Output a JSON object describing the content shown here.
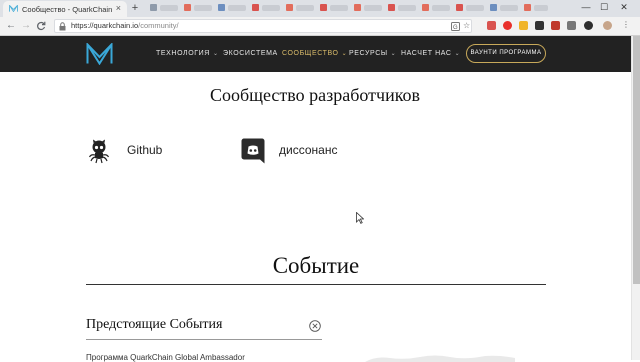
{
  "browser": {
    "tab_title": "Сообщество - QuarkChain",
    "tab_close": "×",
    "new_tab": "+",
    "window_controls": {
      "minimize": "—",
      "maximize": "☐",
      "close": "✕"
    },
    "nav": {
      "back": "←",
      "forward": "→",
      "reload": "C"
    },
    "url_host": "https://quarkchain.io",
    "url_path": "/community/"
  },
  "site": {
    "menu": [
      {
        "label": "ТЕХНОЛОГИЯ",
        "has_caret": true
      },
      {
        "label": "ЭКОСИСТЕМА",
        "has_caret": false
      },
      {
        "label": "СООБЩЕСТВО",
        "has_caret": true,
        "active": true
      },
      {
        "label": "РЕСУРСЫ",
        "has_caret": true
      },
      {
        "label": "НАСЧЕТ НАС",
        "has_caret": true
      }
    ],
    "caret": "⌄",
    "cta_label": "ВАУНТИ ПРОГРАММА",
    "accent_color": "#d9bb6a",
    "header_bg": "#222222"
  },
  "content": {
    "dev_heading": "Сообщество разработчиков",
    "links": [
      {
        "label": "Github",
        "icon": "github-icon"
      },
      {
        "label": "диссонанс",
        "icon": "discord-icon"
      }
    ],
    "event_heading": "Событие",
    "upcoming_heading": "Предстоящие События",
    "clipped_line": "Программа QuarkChain Global Ambassador"
  }
}
